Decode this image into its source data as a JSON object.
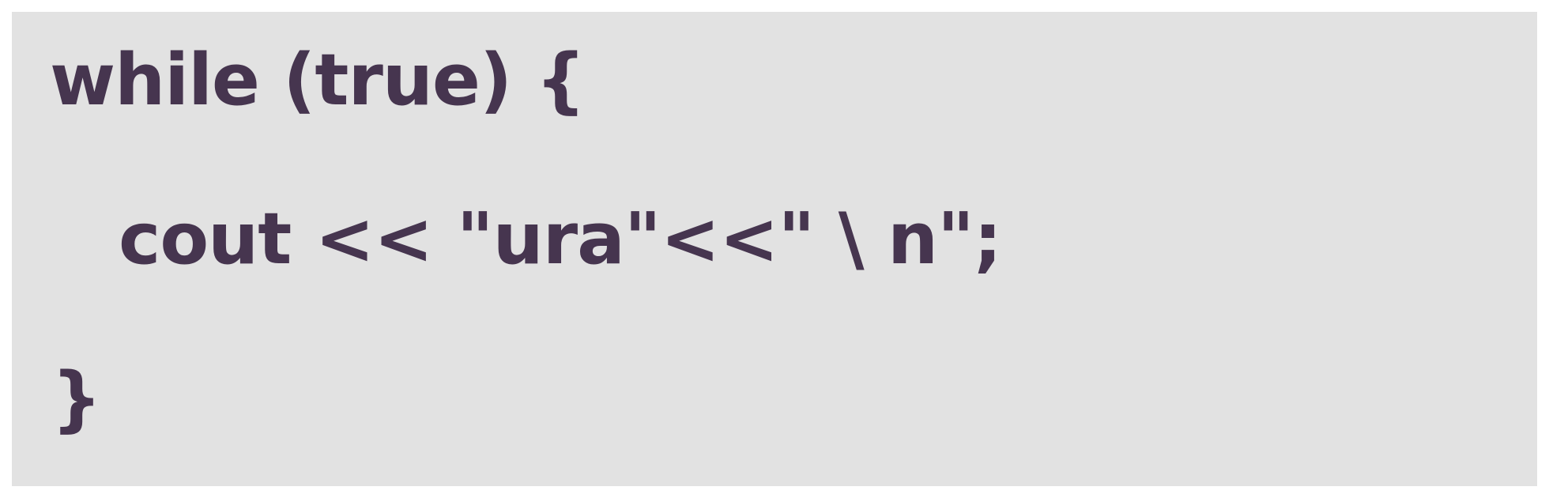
{
  "slide": {
    "background": "#e2e2e2",
    "text_color": "#46354f",
    "code": {
      "line1": "while (true) {",
      "line2": "cout << \"ura\"<<\" \\ n\";",
      "line3": "}"
    }
  }
}
